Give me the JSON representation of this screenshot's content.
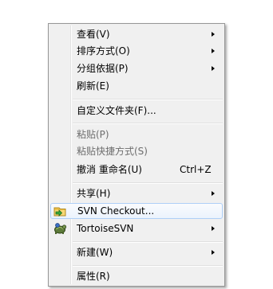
{
  "context_menu": {
    "items": [
      {
        "label": "查看(V)",
        "has_submenu": true
      },
      {
        "label": "排序方式(O)",
        "has_submenu": true
      },
      {
        "label": "分组依据(P)",
        "has_submenu": true
      },
      {
        "label": "刷新(E)",
        "has_submenu": false
      },
      {
        "label": "自定义文件夹(F)...",
        "has_submenu": false
      },
      {
        "label": "粘贴(P)",
        "enabled": false
      },
      {
        "label": "粘贴快捷方式(S)",
        "enabled": false
      },
      {
        "label": "撤消 重命名(U)",
        "shortcut": "Ctrl+Z"
      },
      {
        "label": "共享(H)",
        "has_submenu": true
      },
      {
        "label": "SVN Checkout...",
        "icon": "svn-checkout-icon",
        "highlighted": true
      },
      {
        "label": "TortoiseSVN",
        "icon": "tortoisesvn-icon",
        "has_submenu": true
      },
      {
        "label": "新建(W)",
        "has_submenu": true
      },
      {
        "label": "属性(R)",
        "has_submenu": false
      }
    ]
  },
  "colors": {
    "menu_background": "#f0f0f0",
    "highlight_border": "#aecff7",
    "disabled_text": "#6d6d6d"
  }
}
